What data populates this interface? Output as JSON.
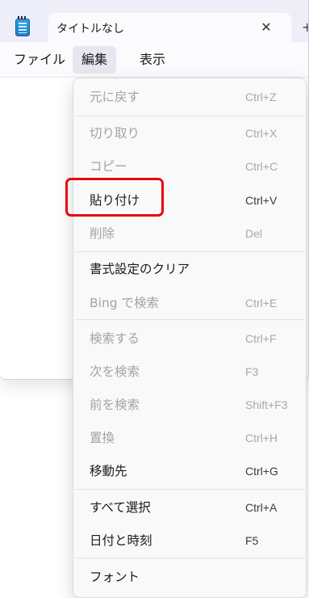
{
  "window": {
    "tab_title": "タイトルなし",
    "tab_close_glyph": "✕",
    "new_tab_glyph": "+",
    "app_icon": "notepad-icon"
  },
  "menubar": {
    "file": "ファイル",
    "edit": "編集",
    "view": "表示"
  },
  "edit_menu": {
    "items": [
      {
        "label": "元に戻す",
        "shortcut": "Ctrl+Z",
        "enabled": false
      },
      {
        "label": "切り取り",
        "shortcut": "Ctrl+X",
        "enabled": false
      },
      {
        "label": "コピー",
        "shortcut": "Ctrl+C",
        "enabled": false
      },
      {
        "label": "貼り付け",
        "shortcut": "Ctrl+V",
        "enabled": true,
        "highlighted": true
      },
      {
        "label": "削除",
        "shortcut": "Del",
        "enabled": false
      },
      {
        "label": "書式設定のクリア",
        "shortcut": "",
        "enabled": true
      },
      {
        "label": "Bing で検索",
        "shortcut": "Ctrl+E",
        "enabled": false
      },
      {
        "label": "検索する",
        "shortcut": "Ctrl+F",
        "enabled": false
      },
      {
        "label": "次を検索",
        "shortcut": "F3",
        "enabled": false
      },
      {
        "label": "前を検索",
        "shortcut": "Shift+F3",
        "enabled": false
      },
      {
        "label": "置換",
        "shortcut": "Ctrl+H",
        "enabled": false
      },
      {
        "label": "移動先",
        "shortcut": "Ctrl+G",
        "enabled": true
      },
      {
        "label": "すべて選択",
        "shortcut": "Ctrl+A",
        "enabled": true
      },
      {
        "label": "日付と時刻",
        "shortcut": "F5",
        "enabled": true
      },
      {
        "label": "フォント",
        "shortcut": "",
        "enabled": true
      }
    ]
  },
  "colors": {
    "highlight": "#e8070b",
    "titlebar": "#eeeef8",
    "menu_bg": "#f9f9f9",
    "disabled_text": "#a3a3a3"
  }
}
